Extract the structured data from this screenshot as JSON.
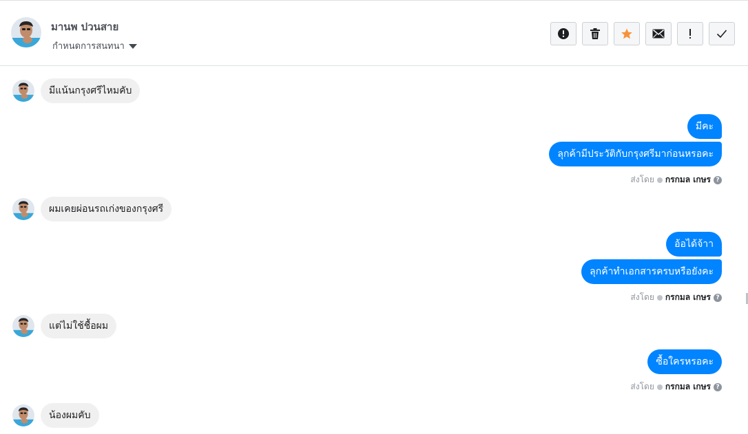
{
  "header": {
    "contact_name": "มานพ ปวนสาย",
    "conversation_settings_label": "กำหนดการสนทนา",
    "toolbar": [
      {
        "name": "report-spam-button",
        "icon": "alert-circle-icon"
      },
      {
        "name": "delete-button",
        "icon": "trash-icon"
      },
      {
        "name": "star-button",
        "icon": "star-icon"
      },
      {
        "name": "mark-unread-button",
        "icon": "envelope-icon"
      },
      {
        "name": "follow-up-button",
        "icon": "exclamation-icon"
      },
      {
        "name": "mark-done-button",
        "icon": "checkmark-icon"
      }
    ]
  },
  "colors": {
    "outgoing_bubble": "#0084ff",
    "incoming_bubble": "#f1f0f0",
    "star": "#f7923a"
  },
  "messages": {
    "in1": "มีแน้นกรุงศรีไหมคับ",
    "out1a": "มีคะ",
    "out1b": "ลุกค้ามีประวัติกับกรุงศรีมาก่อนหรอคะ",
    "in2": "ผมเคยผ่อนรถเก่งของกรุงศรี",
    "out2a": "อ้อได้จ้าา",
    "out2b": "ลุกค้าทำเอกสารครบหรือยังคะ",
    "in3": "แต่ไม่ใช้ชื้อผม",
    "out3": "ซื้อใครหรอคะ",
    "in4": "น้องผมคับ"
  },
  "sent_by": {
    "label": "ส่งโดย",
    "agent": "กรกมล เกษร",
    "help_glyph": "?"
  }
}
